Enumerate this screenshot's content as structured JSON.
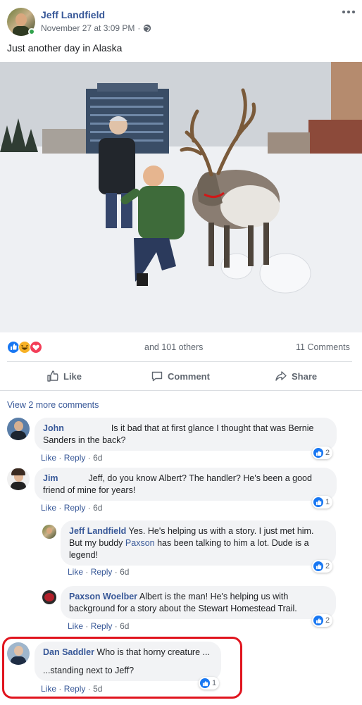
{
  "post": {
    "author": "Jeff Landfield",
    "timestamp": "November 27 at 3:09 PM",
    "separator": "·",
    "text": "Just another day in Alaska",
    "reactions_text": "and 101 others",
    "comments_count": "11 Comments"
  },
  "actions": {
    "like": "Like",
    "comment": "Comment",
    "share": "Share"
  },
  "view_more": "View 2 more comments",
  "comment_actions": {
    "like": "Like",
    "reply": "Reply",
    "dot": "·"
  },
  "comments": [
    {
      "name": "John",
      "text": "Is it bad that at first glance I thought that was Bernie Sanders in the back?",
      "time": "6d",
      "likes": "2"
    },
    {
      "name": "Jim",
      "text": "Jeff, do you know Albert? The handler? He's been a good friend of mine for years!",
      "time": "6d",
      "likes": "1"
    },
    {
      "name": "Jeff Landfield",
      "text_a": "Yes. He's helping us with a story. I just met him. But my buddy",
      "mention": "Paxson",
      "text_b": "has been talking to him a lot. Dude is a legend!",
      "time": "6d",
      "likes": "2"
    },
    {
      "name": "Paxson Woelber",
      "text": "Albert is the man! He's helping us with background for a story about the Stewart Homestead Trail.",
      "time": "6d",
      "likes": "2"
    },
    {
      "name": "Dan Saddler",
      "text_a": "Who is that horny creature ...",
      "text_b": "...standing next to Jeff?",
      "time": "5d",
      "likes": "1"
    }
  ],
  "colors": {
    "link": "#385898",
    "like_blue": "#1877f2",
    "highlight_red": "#e0141e",
    "bubble": "#f2f3f5"
  },
  "icons": [
    "more-icon",
    "globe-icon",
    "like-reaction-icon",
    "haha-reaction-icon",
    "love-reaction-icon",
    "thumbs-up-icon",
    "comment-icon",
    "share-icon"
  ]
}
